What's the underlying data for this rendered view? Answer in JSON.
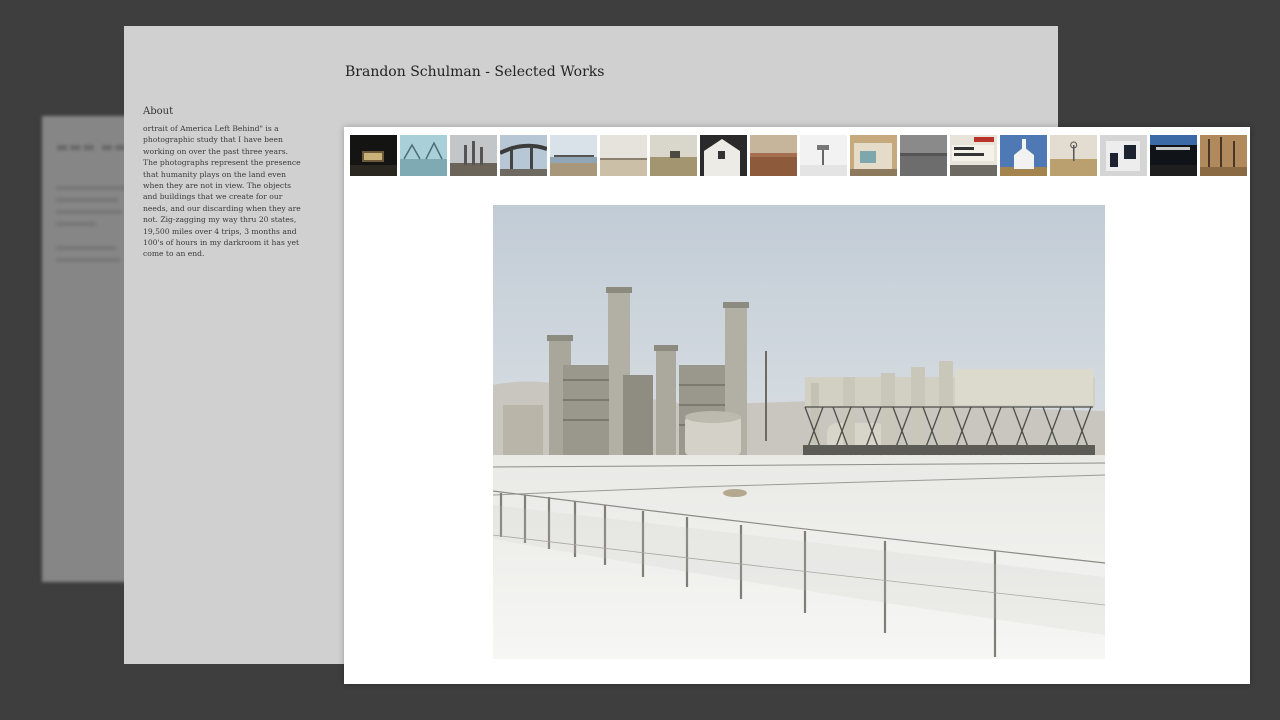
{
  "site": {
    "title": "Brandon Schulman - Selected Works",
    "about_heading": "About",
    "about_text": "ortrait of America Left Behind\" is a photographic study that I have been working on over the past three years. The photographs represent the presence that humanity plays on the land even when they are not in view. The objects and buildings that we create for our needs, and our discarding when they are not. Zig-zagging my way thru 20 states, 19,500 miles over 4 trips, 3 months and 100's of hours in my darkroom it has yet come to an end."
  },
  "gallery": {
    "thumbnail_count": 18,
    "selected_photo": "power-plant-in-snow"
  }
}
